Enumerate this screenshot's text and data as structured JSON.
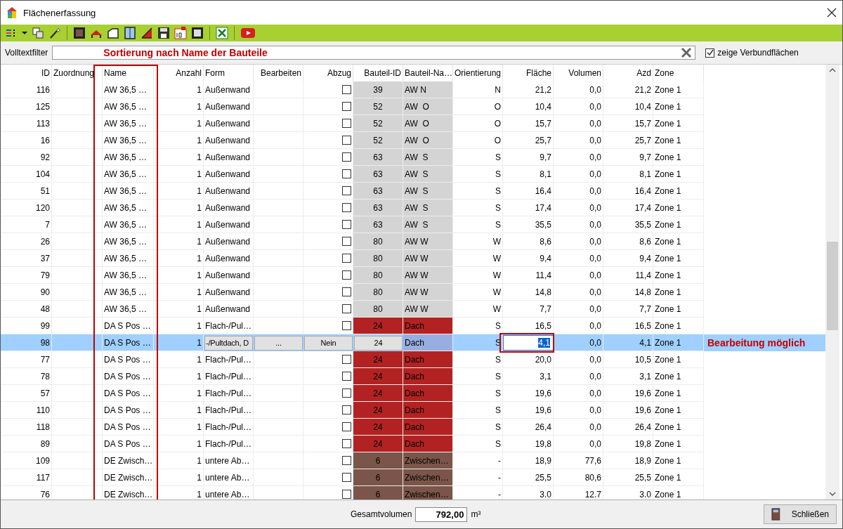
{
  "window": {
    "title": "Flächenerfassung"
  },
  "filter": {
    "label": "Volltextfilter",
    "note": "Sortierung nach Name der Bauteile"
  },
  "show_composite": {
    "label": "zeige Verbundflächen",
    "checked": true
  },
  "table": {
    "columns": [
      "ID",
      "Zuordnung",
      "Name",
      "Anzahl",
      "Form",
      "Bearbeiten",
      "Abzug",
      "Bauteil-ID",
      "Bauteil-Na…",
      "Orientierung",
      "Fläche",
      "Volumen",
      "Azd",
      "Zone"
    ],
    "rows": [
      {
        "id": "116",
        "name": "AW 36,5 …",
        "count": "1",
        "form": "Außenwand",
        "abzug_checked": false,
        "part_id": "39",
        "part_name": "AW N",
        "color": "#d4d4d4",
        "orientation": "N",
        "area": "21,2",
        "volume": "0,0",
        "azd": "21,2",
        "zone": "Zone 1",
        "selected": false
      },
      {
        "id": "125",
        "name": "AW 36,5 …",
        "count": "1",
        "form": "Außenwand",
        "abzug_checked": false,
        "part_id": "52",
        "part_name": "AW  O",
        "color": "#d4d4d4",
        "orientation": "O",
        "area": "10,4",
        "volume": "0,0",
        "azd": "10,4",
        "zone": "Zone 1",
        "selected": false
      },
      {
        "id": "113",
        "name": "AW 36,5 …",
        "count": "1",
        "form": "Außenwand",
        "abzug_checked": false,
        "part_id": "52",
        "part_name": "AW  O",
        "color": "#d4d4d4",
        "orientation": "O",
        "area": "15,7",
        "volume": "0,0",
        "azd": "15,7",
        "zone": "Zone 1",
        "selected": false
      },
      {
        "id": "16",
        "name": "AW 36,5 …",
        "count": "1",
        "form": "Außenwand",
        "abzug_checked": false,
        "part_id": "52",
        "part_name": "AW  O",
        "color": "#d4d4d4",
        "orientation": "O",
        "area": "25,7",
        "volume": "0,0",
        "azd": "25,7",
        "zone": "Zone 1",
        "selected": false
      },
      {
        "id": "92",
        "name": "AW 36,5 …",
        "count": "1",
        "form": "Außenwand",
        "abzug_checked": false,
        "part_id": "63",
        "part_name": "AW  S",
        "color": "#d4d4d4",
        "orientation": "S",
        "area": "9,7",
        "volume": "0,0",
        "azd": "9,7",
        "zone": "Zone 1",
        "selected": false
      },
      {
        "id": "104",
        "name": "AW 36,5 …",
        "count": "1",
        "form": "Außenwand",
        "abzug_checked": false,
        "part_id": "63",
        "part_name": "AW  S",
        "color": "#d4d4d4",
        "orientation": "S",
        "area": "8,1",
        "volume": "0,0",
        "azd": "8,1",
        "zone": "Zone 1",
        "selected": false
      },
      {
        "id": "51",
        "name": "AW 36,5 …",
        "count": "1",
        "form": "Außenwand",
        "abzug_checked": false,
        "part_id": "63",
        "part_name": "AW  S",
        "color": "#d4d4d4",
        "orientation": "S",
        "area": "16,4",
        "volume": "0,0",
        "azd": "16,4",
        "zone": "Zone 1",
        "selected": false
      },
      {
        "id": "120",
        "name": "AW 36,5 …",
        "count": "1",
        "form": "Außenwand",
        "abzug_checked": false,
        "part_id": "63",
        "part_name": "AW  S",
        "color": "#d4d4d4",
        "orientation": "S",
        "area": "17,4",
        "volume": "0,0",
        "azd": "17,4",
        "zone": "Zone 1",
        "selected": false
      },
      {
        "id": "7",
        "name": "AW 36,5 …",
        "count": "1",
        "form": "Außenwand",
        "abzug_checked": false,
        "part_id": "63",
        "part_name": "AW  S",
        "color": "#d4d4d4",
        "orientation": "S",
        "area": "35,5",
        "volume": "0,0",
        "azd": "35,5",
        "zone": "Zone 1",
        "selected": false
      },
      {
        "id": "26",
        "name": "AW 36,5 …",
        "count": "1",
        "form": "Außenwand",
        "abzug_checked": false,
        "part_id": "80",
        "part_name": "AW W",
        "color": "#d4d4d4",
        "orientation": "W",
        "area": "8,6",
        "volume": "0,0",
        "azd": "8,6",
        "zone": "Zone 1",
        "selected": false
      },
      {
        "id": "37",
        "name": "AW 36,5 …",
        "count": "1",
        "form": "Außenwand",
        "abzug_checked": false,
        "part_id": "80",
        "part_name": "AW W",
        "color": "#d4d4d4",
        "orientation": "W",
        "area": "9,4",
        "volume": "0,0",
        "azd": "9,4",
        "zone": "Zone 1",
        "selected": false
      },
      {
        "id": "79",
        "name": "AW 36,5 …",
        "count": "1",
        "form": "Außenwand",
        "abzug_checked": false,
        "part_id": "80",
        "part_name": "AW W",
        "color": "#d4d4d4",
        "orientation": "W",
        "area": "11,4",
        "volume": "0,0",
        "azd": "11,4",
        "zone": "Zone 1",
        "selected": false
      },
      {
        "id": "90",
        "name": "AW 36,5 …",
        "count": "1",
        "form": "Außenwand",
        "abzug_checked": false,
        "part_id": "80",
        "part_name": "AW W",
        "color": "#d4d4d4",
        "orientation": "W",
        "area": "14,8",
        "volume": "0,0",
        "azd": "14,8",
        "zone": "Zone 1",
        "selected": false
      },
      {
        "id": "48",
        "name": "AW 36,5 …",
        "count": "1",
        "form": "Außenwand",
        "abzug_checked": false,
        "part_id": "80",
        "part_name": "AW W",
        "color": "#d4d4d4",
        "orientation": "W",
        "area": "7,7",
        "volume": "0,0",
        "azd": "7,7",
        "zone": "Zone 1",
        "selected": false
      },
      {
        "id": "99",
        "name": "DA S Pos …",
        "count": "1",
        "form": "Flach-/Pul…",
        "abzug_checked": false,
        "part_id": "24",
        "part_name": "Dach",
        "color": "#b22222",
        "orientation": "S",
        "area": "16,5",
        "volume": "0,0",
        "azd": "16,5",
        "zone": "Zone 1",
        "selected": false
      },
      {
        "id": "98",
        "name": "DA S Pos …",
        "count": "1",
        "form": "-/Pultdach, D",
        "edit": "...",
        "abzug": "Nein",
        "part_id": "24",
        "part_name": "Dach",
        "orientation": "S",
        "area": "4,1",
        "volume": "0,0",
        "azd": "4,1",
        "zone": "Zone 1",
        "selected": true
      },
      {
        "id": "77",
        "name": "DA S Pos …",
        "count": "1",
        "form": "Flach-/Pul…",
        "abzug_checked": false,
        "part_id": "24",
        "part_name": "Dach",
        "color": "#b22222",
        "orientation": "S",
        "area": "20,0",
        "volume": "0,0",
        "azd": "10,5",
        "zone": "Zone 1",
        "selected": false
      },
      {
        "id": "78",
        "name": "DA S Pos …",
        "count": "1",
        "form": "Flach-/Pul…",
        "abzug_checked": false,
        "part_id": "24",
        "part_name": "Dach",
        "color": "#b22222",
        "orientation": "S",
        "area": "3,1",
        "volume": "0,0",
        "azd": "3,1",
        "zone": "Zone 1",
        "selected": false
      },
      {
        "id": "57",
        "name": "DA S Pos …",
        "count": "1",
        "form": "Flach-/Pul…",
        "abzug_checked": false,
        "part_id": "24",
        "part_name": "Dach",
        "color": "#b22222",
        "orientation": "S",
        "area": "19,6",
        "volume": "0,0",
        "azd": "19,6",
        "zone": "Zone 1",
        "selected": false
      },
      {
        "id": "110",
        "name": "DA S Pos …",
        "count": "1",
        "form": "Flach-/Pul…",
        "abzug_checked": false,
        "part_id": "24",
        "part_name": "Dach",
        "color": "#b22222",
        "orientation": "S",
        "area": "19,6",
        "volume": "0,0",
        "azd": "19,6",
        "zone": "Zone 1",
        "selected": false
      },
      {
        "id": "118",
        "name": "DA S Pos …",
        "count": "1",
        "form": "Flach-/Pul…",
        "abzug_checked": false,
        "part_id": "24",
        "part_name": "Dach",
        "color": "#b22222",
        "orientation": "S",
        "area": "26,4",
        "volume": "0,0",
        "azd": "26,4",
        "zone": "Zone 1",
        "selected": false
      },
      {
        "id": "89",
        "name": "DA S Pos …",
        "count": "1",
        "form": "Flach-/Pul…",
        "abzug_checked": false,
        "part_id": "24",
        "part_name": "Dach",
        "color": "#b22222",
        "orientation": "S",
        "area": "19,8",
        "volume": "0,0",
        "azd": "19,8",
        "zone": "Zone 1",
        "selected": false
      },
      {
        "id": "109",
        "name": "DE Zwisch…",
        "count": "1",
        "form": "untere Ab…",
        "abzug_checked": false,
        "part_id": "6",
        "part_name": "Zwischen…",
        "color": "#7b5549",
        "orientation": "-",
        "area": "18,9",
        "volume": "77,6",
        "azd": "18,9",
        "zone": "Zone 1",
        "selected": false
      },
      {
        "id": "117",
        "name": "DE Zwisch…",
        "count": "1",
        "form": "untere Ab…",
        "abzug_checked": false,
        "part_id": "6",
        "part_name": "Zwischen…",
        "color": "#7b5549",
        "orientation": "-",
        "area": "25,5",
        "volume": "80,6",
        "azd": "25,5",
        "zone": "Zone 1",
        "selected": false
      },
      {
        "id": "76",
        "name": "DE Zwisch…",
        "count": "1",
        "form": "untere Ab…",
        "abzug_checked": false,
        "part_id": "6",
        "part_name": "Zwischen…",
        "color": "#7b5549",
        "orientation": "-",
        "area": "3.0",
        "volume": "12.7",
        "azd": "3.0",
        "zone": "Zone 1",
        "selected": false
      }
    ]
  },
  "edit_note": "Bearbeitung möglich",
  "footer": {
    "total_label": "Gesamtvolumen",
    "total_value": "792,00",
    "unit": "m³",
    "close_button": "Schließen"
  }
}
